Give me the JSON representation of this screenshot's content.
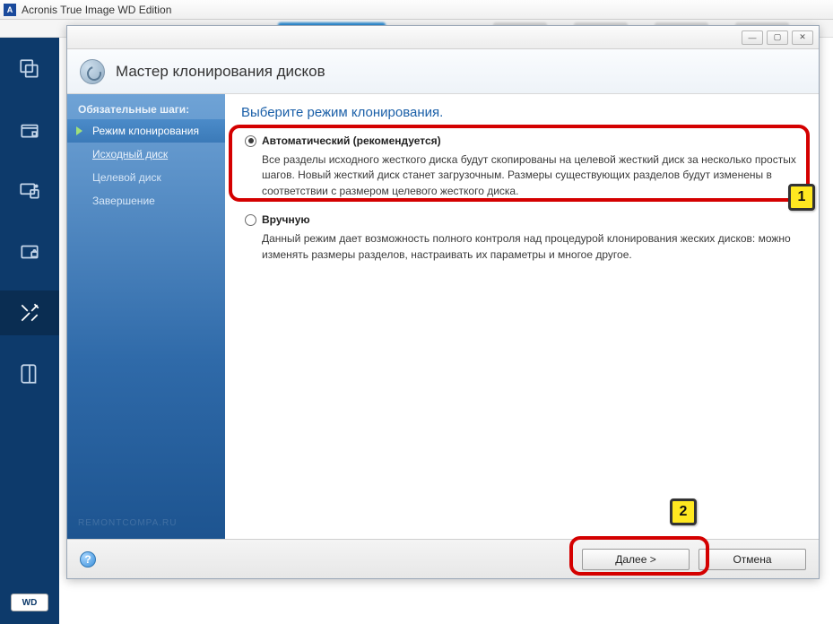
{
  "app": {
    "title": "Acronis True Image WD Edition",
    "icon_letter": "A"
  },
  "main_sidebar": {
    "items": [
      {
        "name": "backup-icon"
      },
      {
        "name": "archive-icon"
      },
      {
        "name": "sync-icon"
      },
      {
        "name": "security-icon"
      },
      {
        "name": "tools-icon",
        "active": true
      },
      {
        "name": "log-icon"
      }
    ],
    "wd_label": "WD"
  },
  "wizard": {
    "title": "Мастер клонирования дисков",
    "window_controls": {
      "minimize": "—",
      "maximize": "▢",
      "close": "✕"
    },
    "steps_header": "Обязательные шаги:",
    "steps": [
      {
        "label": "Режим клонирования",
        "state": "current"
      },
      {
        "label": "Исходный диск",
        "state": "link"
      },
      {
        "label": "Целевой диск",
        "state": "pending"
      },
      {
        "label": "Завершение",
        "state": "pending"
      }
    ],
    "content": {
      "heading": "Выберите режим клонирования.",
      "options": [
        {
          "id": "auto",
          "checked": true,
          "title": "Автоматический (рекомендуется)",
          "desc": "Все разделы исходного жесткого диска будут скопированы на целевой жесткий диск за несколько простых шагов. Новый жесткий диск станет загрузочным. Размеры существующих разделов будут изменены в соответствии с размером целевого жесткого диска."
        },
        {
          "id": "manual",
          "checked": false,
          "title": "Вручную",
          "desc": "Данный режим дает возможность полного контроля над процедурой клонирования жеских дисков: можно изменять размеры разделов, настраивать их параметры и многое другое."
        }
      ]
    },
    "footer": {
      "help": "?",
      "next": "Далее >",
      "cancel": "Отмена"
    }
  },
  "callouts": {
    "one": "1",
    "two": "2"
  }
}
